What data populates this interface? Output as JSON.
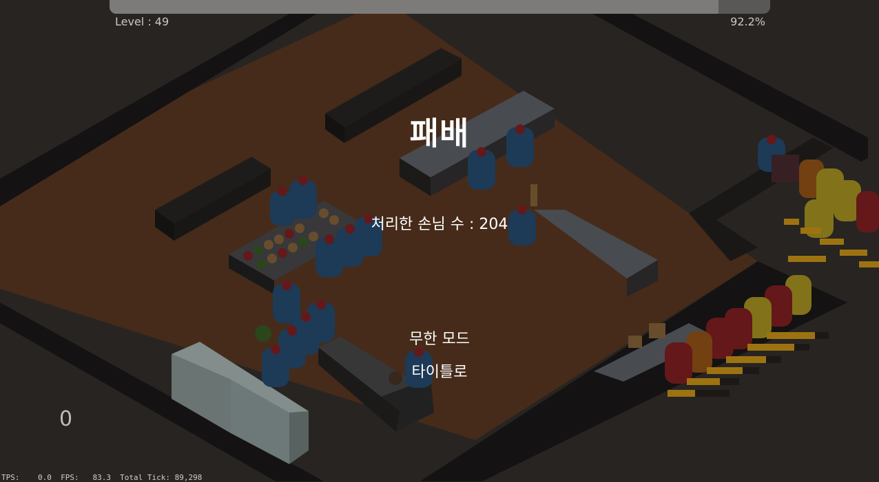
{
  "hud": {
    "level_label": "Level : 49",
    "progress_percent_label": "92.2%",
    "progress_fraction": 0.922,
    "left_counter": "0",
    "debug_stats": "TPS:    0.0  FPS:   83.3  Total Tick: 89,298"
  },
  "result": {
    "title": "패배",
    "served_customers": "처리한 손님 수 : 204"
  },
  "menu": {
    "infinite_mode": "무한 모드",
    "to_title": "타이틀로"
  },
  "colors": {
    "background": "#2b2623",
    "floor": "#4a2e1c",
    "wall": "#1a1817",
    "player_blue": "#1f3e5c",
    "customer_red": "#6a1a1c",
    "customer_yellow": "#8a7a1c",
    "patience_bar": "#a67a14"
  }
}
